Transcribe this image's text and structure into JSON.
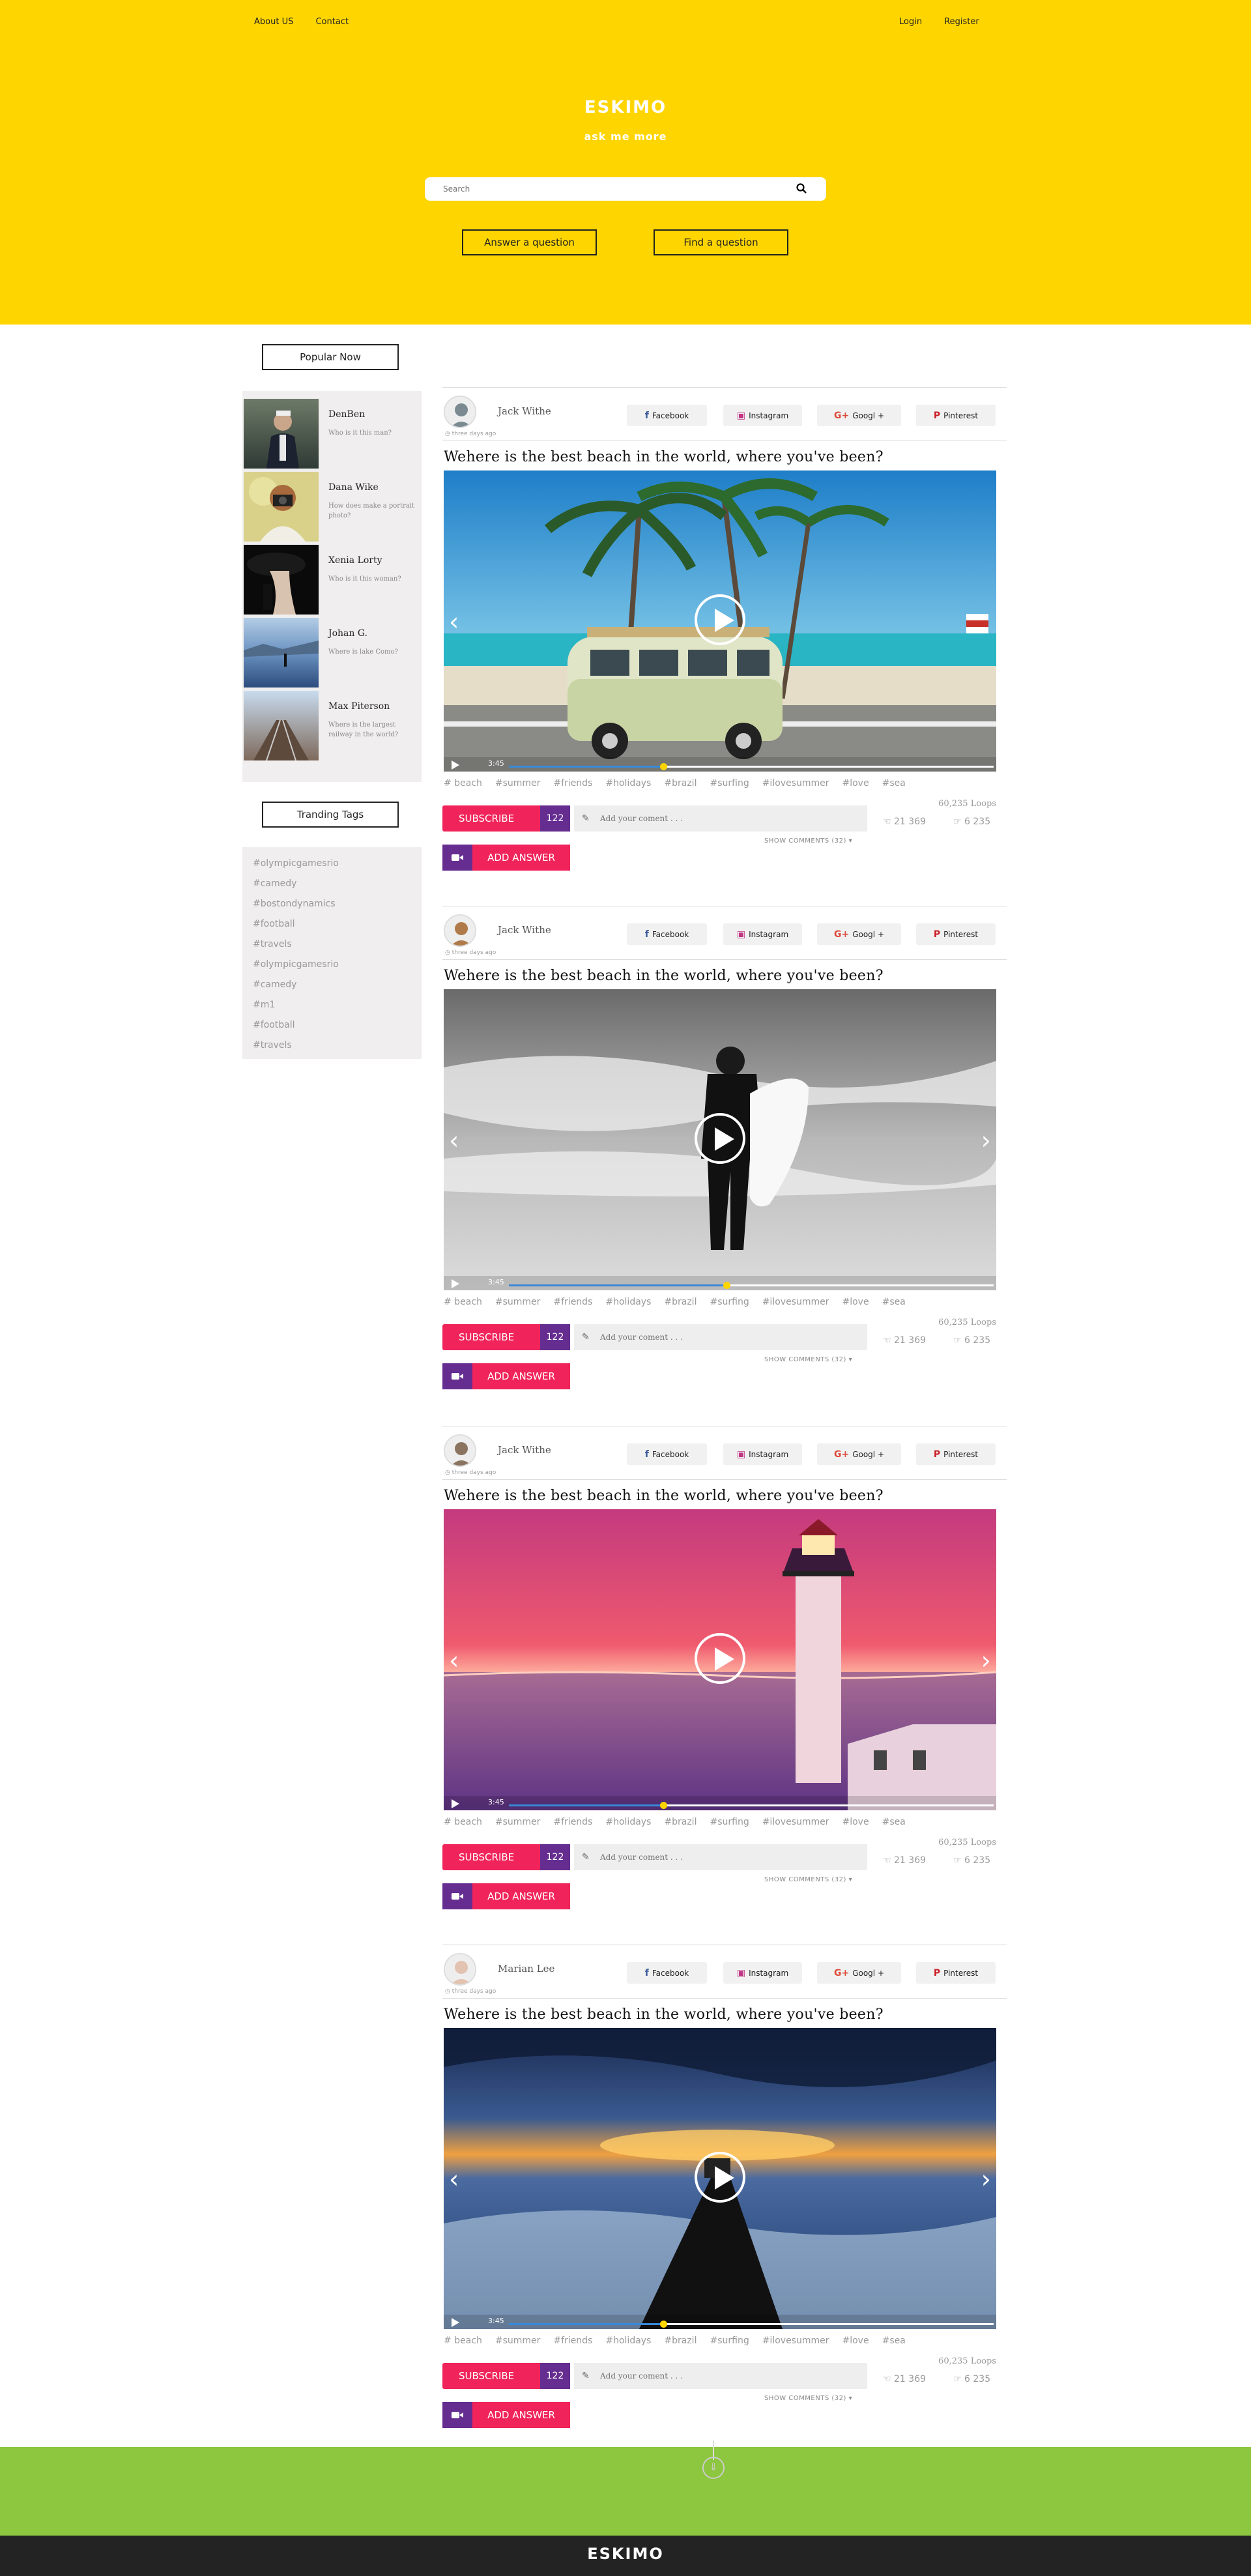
{
  "nav": {
    "about": "About US",
    "contact": "Contact",
    "login": "Login",
    "register": "Register"
  },
  "brand": {
    "logo": "ESKIMO",
    "tagline": "ask me more"
  },
  "search": {
    "placeholder": "Search"
  },
  "hero": {
    "answer_btn": "Answer a question",
    "find_btn": "Find a question"
  },
  "sidebar": {
    "popular_title": "Popular Now",
    "popular": [
      {
        "name": "DenBen",
        "question": "Who is it this man?"
      },
      {
        "name": "Dana Wike",
        "question": "How does make a portrait photo?"
      },
      {
        "name": "Xenia Lorty",
        "question": "Who is it this woman?"
      },
      {
        "name": "Johan G.",
        "question": "Where is lake Como?"
      },
      {
        "name": "Max Piterson",
        "question": "Where is the largest railway in the world?"
      }
    ],
    "tags_title": "Tranding Tags",
    "tags": [
      "#olympicgamesrio",
      "#camedy",
      "#bostondynamics",
      "#football",
      "#travels",
      "#olympicgamesrio",
      "#camedy",
      "#m1",
      "#football",
      "#travels"
    ]
  },
  "share": {
    "facebook": "Facebook",
    "instagram": "Instagram",
    "google": "Googl +",
    "pinterest": "Pinterest"
  },
  "common": {
    "hashtags": [
      "# beach",
      "#summer",
      "#friends",
      "#holidays",
      "#brazil",
      "#surfing",
      "#ilovesummer",
      "#love",
      "#sea"
    ],
    "subscribe": "SUBSCRIBE",
    "subscribe_count": "122",
    "comment_placeholder": "Add your coment . . .",
    "show_comments": "SHOW COMMENTS (32)",
    "loops": "60,235 Loops",
    "likes": "21 369",
    "dislikes": "6 235",
    "add_answer": "ADD ANSWER",
    "video_time": "3:45"
  },
  "posts": [
    {
      "author": "Jack Withe",
      "time": "three days ago",
      "title": "Wehere is the best beach in the world, where you've been?",
      "progress": 0.32
    },
    {
      "author": "Jack Withe",
      "time": "three days ago",
      "title": "Wehere is the best beach in the world, where you've been?",
      "progress": 0.45
    },
    {
      "author": "Jack Withe",
      "time": "three days ago",
      "title": "Wehere is the best beach in the world, where you've been?",
      "progress": 0.32
    },
    {
      "author": "Marian Lee",
      "time": "three days ago",
      "title": "Wehere is the best beach in the world, where you've been?",
      "progress": 0.32
    }
  ],
  "footer": {
    "logo": "ESKIMO"
  },
  "colors": {
    "brand_yellow": "#ffd500",
    "subscribe_pink": "#f0245a",
    "accent_purple": "#662d91",
    "footer_green": "#8dc63f",
    "footer_dark": "#232323"
  }
}
